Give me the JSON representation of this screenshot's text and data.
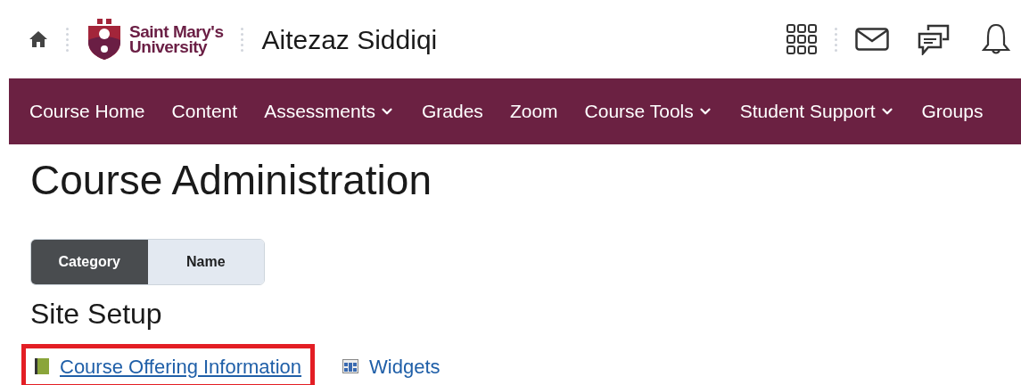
{
  "header": {
    "logo": {
      "line1": "Saint Mary's",
      "line2": "University"
    },
    "user_name": "Aitezaz Siddiqi"
  },
  "nav": [
    {
      "label": "Course Home",
      "has_menu": false
    },
    {
      "label": "Content",
      "has_menu": false
    },
    {
      "label": "Assessments",
      "has_menu": true
    },
    {
      "label": "Grades",
      "has_menu": false
    },
    {
      "label": "Zoom",
      "has_menu": false
    },
    {
      "label": "Course Tools",
      "has_menu": true
    },
    {
      "label": "Student Support",
      "has_menu": true
    },
    {
      "label": "Groups",
      "has_menu": false
    }
  ],
  "page_title": "Course Administration",
  "view_toggle": [
    {
      "label": "Category",
      "selected": true
    },
    {
      "label": "Name",
      "selected": false
    }
  ],
  "section": {
    "title": "Site Setup",
    "links": [
      {
        "label": "Course Offering Information",
        "kind": "book",
        "highlighted": true
      },
      {
        "label": "Widgets",
        "kind": "widget",
        "highlighted": false
      }
    ]
  }
}
